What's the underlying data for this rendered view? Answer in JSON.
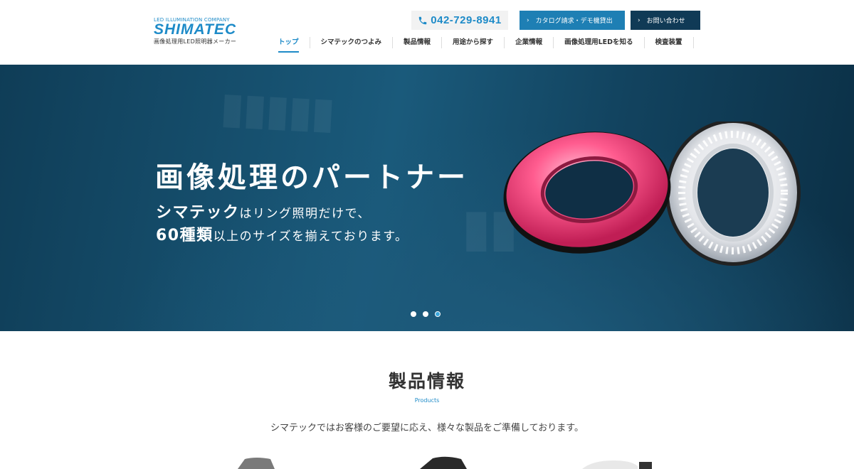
{
  "header": {
    "logo": {
      "tagline": "LED ILLUMINATION COMPANY",
      "name": "SHIMATEC",
      "subtitle": "画像処理用LED照明器メーカー"
    },
    "phone": {
      "number": "042-729-8941",
      "icon": "phone-icon"
    },
    "buttons": {
      "catalog": "カタログ請求・デモ機貸出",
      "contact": "お問い合わせ",
      "arrow": "›"
    },
    "nav": [
      {
        "label": "トップ",
        "active": true
      },
      {
        "label": "シマテックのつよみ"
      },
      {
        "label": "製品情報"
      },
      {
        "label": "用途から探す"
      },
      {
        "label": "企業情報"
      },
      {
        "label": "画像処理用LEDを知る"
      },
      {
        "label": "検査装置"
      }
    ]
  },
  "hero": {
    "title": "画像処理のパートナー",
    "line1_strong": "シマテック",
    "line1_rest": "はリング照明だけで、",
    "line2_strong": "60種類",
    "line2_rest": "以上のサイズを揃えております。",
    "slides": 3,
    "active_slide": 3
  },
  "products": {
    "title": "製品情報",
    "subtitle": "Products",
    "description": "シマテックではお客様のご要望に応え、様々な製品をご準備しております。"
  },
  "colors": {
    "accent": "#1e8bc8",
    "button_primary": "#1e7fb4",
    "button_dark": "#103a56",
    "hero_bg": "#174f6e"
  }
}
